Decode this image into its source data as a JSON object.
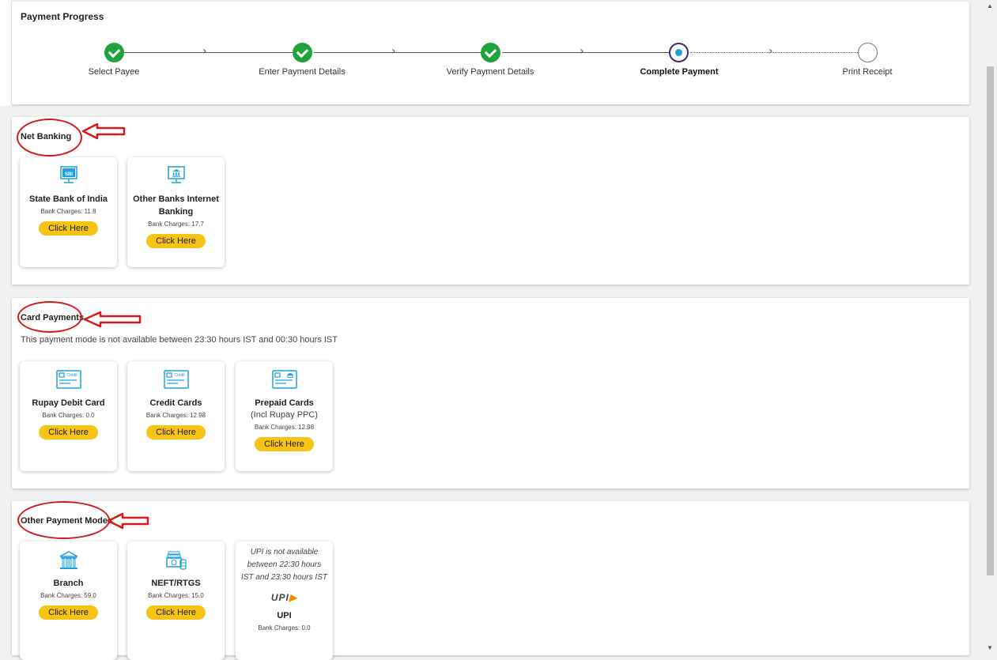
{
  "progress": {
    "title": "Payment Progress",
    "steps": [
      {
        "label": "Select Payee",
        "state": "done"
      },
      {
        "label": "Enter Payment Details",
        "state": "done"
      },
      {
        "label": "Verify Payment Details",
        "state": "done"
      },
      {
        "label": "Complete Payment",
        "state": "current"
      },
      {
        "label": "Print Receipt",
        "state": "pending"
      }
    ]
  },
  "net_banking": {
    "title": "Net Banking",
    "cards": [
      {
        "name": "State Bank of India",
        "charges": "Bank Charges: 11.8",
        "button": "Click Here",
        "icon": "sbi-monitor-icon"
      },
      {
        "name": "Other Banks Internet Banking",
        "charges": "Bank Charges: 17.7",
        "button": "Click Here",
        "icon": "bank-monitor-icon"
      }
    ]
  },
  "card_payments": {
    "title": "Card Payments",
    "note": "This payment mode is not available between 23:30 hours IST and 00:30 hours IST",
    "cards": [
      {
        "name": "Rupay Debit Card",
        "charges": "Bank Charges: 0.0",
        "button": "Click Here",
        "icon": "credit-card-icon"
      },
      {
        "name": "Credit Cards",
        "charges": "Bank Charges: 12.98",
        "button": "Click Here",
        "icon": "credit-card-icon"
      },
      {
        "name": "Prepaid Cards",
        "sub": "(Incl Rupay PPC)",
        "charges": "Bank Charges: 12.98",
        "button": "Click Here",
        "icon": "prepaid-card-icon"
      }
    ]
  },
  "other_modes": {
    "title": "Other Payment Modes",
    "cards": [
      {
        "name": "Branch",
        "charges": "Bank Charges: 59.0",
        "button": "Click Here",
        "icon": "bank-building-icon"
      },
      {
        "name": "NEFT/RTGS",
        "charges": "Bank Charges: 15.0",
        "button": "Click Here",
        "icon": "cash-transfer-icon"
      },
      {
        "name": "UPI",
        "note": "UPI is not available between 22:30 hours IST and 23:30 hours IST",
        "logo": "UPI",
        "charges": "Bank Charges: 0.0",
        "icon": "upi-logo"
      }
    ]
  },
  "colors": {
    "accent_button": "#f7c416",
    "done_step": "#1fa33a",
    "icon_blue": "#1ba1e2",
    "annotation_red": "#d61a1a"
  }
}
